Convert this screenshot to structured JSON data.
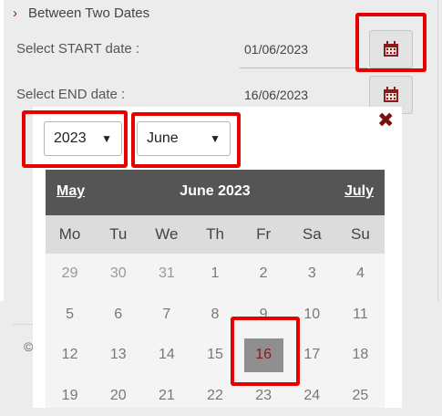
{
  "section": {
    "title": "Between Two Dates",
    "chevron_icon": "chevron-right-icon"
  },
  "start": {
    "label": "Select START date :",
    "value": "01/06/2023",
    "button_icon": "calendar-icon"
  },
  "end": {
    "label": "Select END date :",
    "value": "16/06/2023",
    "button_icon": "calendar-icon"
  },
  "footer": {
    "fragment": "©"
  },
  "colors": {
    "accent": "#8b1a1a",
    "highlight": "#e60000",
    "header_bg": "#555555"
  },
  "datepicker": {
    "year": "2023",
    "month": "June",
    "close_icon": "close-icon",
    "prev_month": "May",
    "next_month": "July",
    "title": "June 2023",
    "weekdays": [
      "Mo",
      "Tu",
      "We",
      "Th",
      "Fr",
      "Sa",
      "Su"
    ],
    "selected_day": "16",
    "weeks": [
      [
        "29",
        "30",
        "31",
        "1",
        "2",
        "3",
        "4"
      ],
      [
        "5",
        "6",
        "7",
        "8",
        "9",
        "10",
        "11"
      ],
      [
        "12",
        "13",
        "14",
        "15",
        "16",
        "17",
        "18"
      ],
      [
        "19",
        "20",
        "21",
        "22",
        "23",
        "24",
        "25"
      ]
    ]
  }
}
